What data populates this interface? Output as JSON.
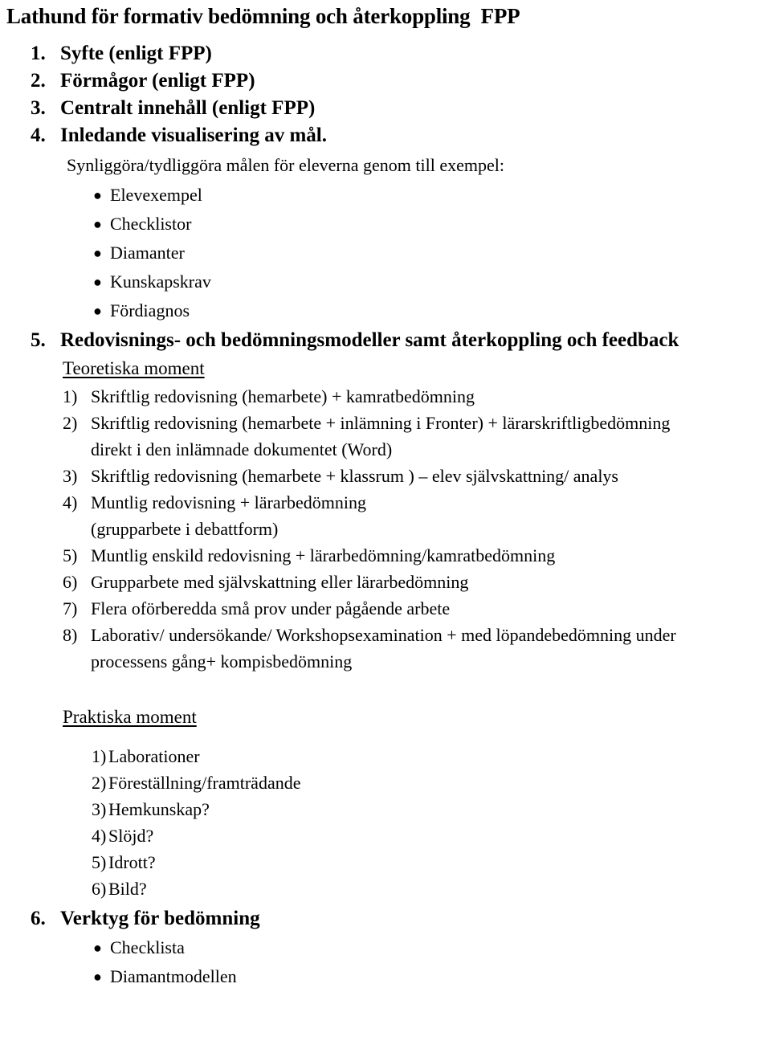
{
  "document": {
    "title": "Lathund för formativ bedömning och återkoppling  FPP"
  },
  "main_list": [
    {
      "num": "1.",
      "text": "Syfte (enligt FPP)"
    },
    {
      "num": "2.",
      "text": "Förmågor (enligt FPP)"
    },
    {
      "num": "3.",
      "text": "Centralt innehåll (enligt FPP)"
    },
    {
      "num": "4.",
      "text": "Inledande visualisering av mål."
    },
    {
      "num": "5.",
      "text": "Redovisnings- och bedömningsmodeller samt återkoppling och feedback"
    },
    {
      "num": "6.",
      "text": "Verktyg för bedömning"
    }
  ],
  "section4": {
    "intro": "Synliggöra/tydliggöra målen för eleverna genom till exempel:",
    "bullet_glyph": "bullet-dot-icon",
    "bullets": [
      "Elevexempel",
      "Checklistor",
      "Diamanter",
      "Kunskapskrav",
      "Fördiagnos"
    ]
  },
  "section5": {
    "theory_heading": "Teoretiska moment",
    "theory_items": [
      {
        "num": "1)",
        "line1": "Skriftlig redovisning (hemarbete) + kamratbedömning",
        "line2": ""
      },
      {
        "num": "2)",
        "line1": "Skriftlig redovisning (hemarbete + inlämning i Fronter) + lärarskriftligbedömning",
        "line2": "direkt i den inlämnade dokumentet (Word)"
      },
      {
        "num": "3)",
        "line1": "Skriftlig redovisning (hemarbete + klassrum ) – elev självskattning/ analys",
        "line2": ""
      },
      {
        "num": "4)",
        "line1": "Muntlig redovisning + lärarbedömning",
        "line2": "(grupparbete i debattform)"
      },
      {
        "num": "5)",
        "line1": "Muntlig enskild redovisning + lärarbedömning/kamratbedömning",
        "line2": ""
      },
      {
        "num": "6)",
        "line1": "Grupparbete med självskattning eller lärarbedömning",
        "line2": ""
      },
      {
        "num": "7)",
        "line1": "Flera oförberedda små prov under pågående arbete",
        "line2": ""
      },
      {
        "num": "8)",
        "line1": "Laborativ/ undersökande/ Workshopsexamination + med löpandebedömning under",
        "line2": "processens gång+ kompisbedömning"
      }
    ],
    "practical_heading": "Praktiska moment",
    "practical_items": [
      {
        "num": "1)",
        "text": "Laborationer"
      },
      {
        "num": "2)",
        "text": "Föreställning/framträdande"
      },
      {
        "num": "3)",
        "text": "Hemkunskap?"
      },
      {
        "num": "4)",
        "text": "Slöjd?"
      },
      {
        "num": "5)",
        "text": "Idrott?"
      },
      {
        "num": "6)",
        "text": "Bild?"
      }
    ]
  },
  "section6": {
    "bullet_glyph": "bullet-dot-icon",
    "bullets": [
      "Checklista",
      "Diamantmodellen"
    ]
  }
}
